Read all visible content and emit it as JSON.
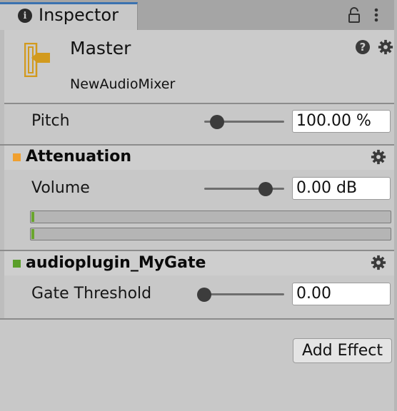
{
  "tab": {
    "label": "Inspector"
  },
  "header": {
    "title": "Master",
    "subtitle": "NewAudioMixer"
  },
  "pitch": {
    "label": "Pitch",
    "value": "100.00 %",
    "slider_level": 0.16
  },
  "attenuation": {
    "title": "Attenuation",
    "color": "#f0a030",
    "volume": {
      "label": "Volume",
      "value": "0.00 dB",
      "slider_level": 0.77
    },
    "meters": [
      {
        "level": 0.01
      },
      {
        "level": 0.01
      }
    ]
  },
  "plugin": {
    "title": "audioplugin_MyGate",
    "color": "#5a9e2a",
    "gate": {
      "label": "Gate Threshold",
      "value": "0.00",
      "slider_level": 0.0
    }
  },
  "add_effect": {
    "label": "Add Effect"
  },
  "icons": {
    "tab": "info-icon",
    "lock": "lock-icon",
    "menu": "kebab-menu-icon",
    "mixer": "audio-mixer-icon",
    "help": "help-icon",
    "settings": "gear-icon"
  }
}
